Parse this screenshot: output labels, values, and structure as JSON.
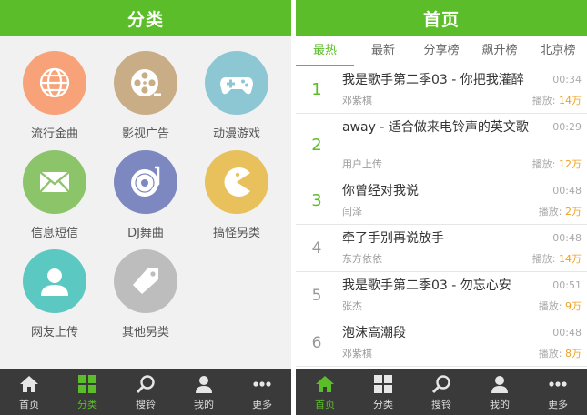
{
  "left": {
    "title": "分类",
    "categories": [
      {
        "label": "流行金曲",
        "icon": "globe-icon",
        "color": "#f8a27a"
      },
      {
        "label": "影视广告",
        "icon": "film-reel-icon",
        "color": "#c9ad86"
      },
      {
        "label": "动漫游戏",
        "icon": "gamepad-icon",
        "color": "#8cc7d3"
      },
      {
        "label": "信息短信",
        "icon": "envelope-icon",
        "color": "#8cc46a"
      },
      {
        "label": "DJ舞曲",
        "icon": "turntable-icon",
        "color": "#7c88bf"
      },
      {
        "label": "搞怪另类",
        "icon": "pacman-icon",
        "color": "#e8c05c"
      },
      {
        "label": "网友上传",
        "icon": "user-icon",
        "color": "#5cc8c2"
      },
      {
        "label": "其他另类",
        "icon": "tag-icon",
        "color": "#bdbdbd"
      }
    ],
    "tabbar": [
      {
        "label": "首页",
        "icon": "home-icon",
        "active": false
      },
      {
        "label": "分类",
        "icon": "grid-icon",
        "active": true
      },
      {
        "label": "搜铃",
        "icon": "search-icon",
        "active": false
      },
      {
        "label": "我的",
        "icon": "person-icon",
        "active": false
      },
      {
        "label": "更多",
        "icon": "more-icon",
        "active": false
      }
    ]
  },
  "right": {
    "title": "首页",
    "subtabs": [
      "最热",
      "最新",
      "分享榜",
      "飙升榜",
      "北京榜"
    ],
    "songs": [
      {
        "rank": "1",
        "title": "我是歌手第二季03 - 你把我灌醉",
        "artist": "邓紫棋",
        "duration": "00:34",
        "plays_label": "播放:",
        "plays": "14万"
      },
      {
        "rank": "2",
        "title": "away - 适合做来电铃声的英文歌",
        "artist": "用户上传",
        "duration": "00:29",
        "plays_label": "播放:",
        "plays": "12万"
      },
      {
        "rank": "3",
        "title": "你曾经对我说",
        "artist": "闫泽",
        "duration": "00:48",
        "plays_label": "播放:",
        "plays": "2万"
      },
      {
        "rank": "4",
        "title": "牵了手别再说放手",
        "artist": "东方依依",
        "duration": "00:48",
        "plays_label": "播放:",
        "plays": "14万"
      },
      {
        "rank": "5",
        "title": "我是歌手第二季03 - 勿忘心安",
        "artist": "张杰",
        "duration": "00:51",
        "plays_label": "播放:",
        "plays": "9万"
      },
      {
        "rank": "6",
        "title": "泡沫高潮段",
        "artist": "邓紫棋",
        "duration": "00:48",
        "plays_label": "播放:",
        "plays": "8万"
      }
    ],
    "tabbar": [
      {
        "label": "首页",
        "icon": "home-icon",
        "active": true
      },
      {
        "label": "分类",
        "icon": "grid-icon",
        "active": false
      },
      {
        "label": "搜铃",
        "icon": "search-icon",
        "active": false
      },
      {
        "label": "我的",
        "icon": "person-icon",
        "active": false
      },
      {
        "label": "更多",
        "icon": "more-icon",
        "active": false
      }
    ]
  }
}
